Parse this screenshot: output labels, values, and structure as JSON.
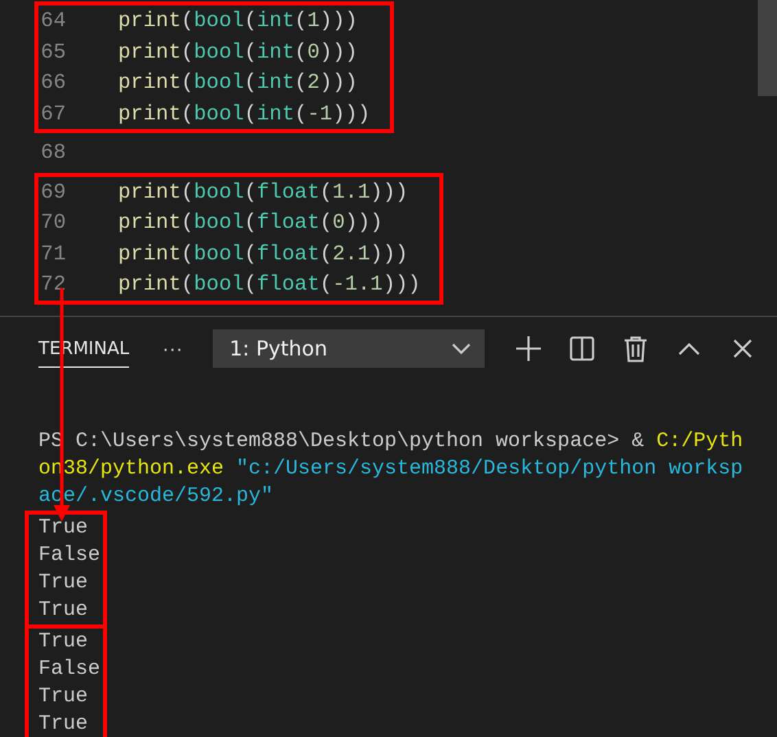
{
  "editor": {
    "blocks": [
      {
        "highlighted": true,
        "lines": [
          {
            "number": "64",
            "tokens": [
              {
                "kind": "func",
                "text": "print"
              },
              {
                "kind": "punct",
                "text": "("
              },
              {
                "kind": "type",
                "text": "bool"
              },
              {
                "kind": "punct",
                "text": "("
              },
              {
                "kind": "type",
                "text": "int"
              },
              {
                "kind": "punct",
                "text": "("
              },
              {
                "kind": "number",
                "text": "1"
              },
              {
                "kind": "punct",
                "text": ")))"
              }
            ]
          },
          {
            "number": "65",
            "tokens": [
              {
                "kind": "func",
                "text": "print"
              },
              {
                "kind": "punct",
                "text": "("
              },
              {
                "kind": "type",
                "text": "bool"
              },
              {
                "kind": "punct",
                "text": "("
              },
              {
                "kind": "type",
                "text": "int"
              },
              {
                "kind": "punct",
                "text": "("
              },
              {
                "kind": "number",
                "text": "0"
              },
              {
                "kind": "punct",
                "text": ")))"
              }
            ]
          },
          {
            "number": "66",
            "tokens": [
              {
                "kind": "func",
                "text": "print"
              },
              {
                "kind": "punct",
                "text": "("
              },
              {
                "kind": "type",
                "text": "bool"
              },
              {
                "kind": "punct",
                "text": "("
              },
              {
                "kind": "type",
                "text": "int"
              },
              {
                "kind": "punct",
                "text": "("
              },
              {
                "kind": "number",
                "text": "2"
              },
              {
                "kind": "punct",
                "text": ")))"
              }
            ]
          },
          {
            "number": "67",
            "tokens": [
              {
                "kind": "func",
                "text": "print"
              },
              {
                "kind": "punct",
                "text": "("
              },
              {
                "kind": "type",
                "text": "bool"
              },
              {
                "kind": "punct",
                "text": "("
              },
              {
                "kind": "type",
                "text": "int"
              },
              {
                "kind": "punct",
                "text": "("
              },
              {
                "kind": "number",
                "text": "-1"
              },
              {
                "kind": "punct",
                "text": ")))"
              }
            ]
          }
        ]
      },
      {
        "highlighted": false,
        "lines": [
          {
            "number": "68"
          }
        ]
      },
      {
        "highlighted": true,
        "lines": [
          {
            "number": "69",
            "tokens": [
              {
                "kind": "func",
                "text": "print"
              },
              {
                "kind": "punct",
                "text": "("
              },
              {
                "kind": "type",
                "text": "bool"
              },
              {
                "kind": "punct",
                "text": "("
              },
              {
                "kind": "type",
                "text": "float"
              },
              {
                "kind": "punct",
                "text": "("
              },
              {
                "kind": "number",
                "text": "1.1"
              },
              {
                "kind": "punct",
                "text": ")))"
              }
            ]
          },
          {
            "number": "70",
            "tokens": [
              {
                "kind": "func",
                "text": "print"
              },
              {
                "kind": "punct",
                "text": "("
              },
              {
                "kind": "type",
                "text": "bool"
              },
              {
                "kind": "punct",
                "text": "("
              },
              {
                "kind": "type",
                "text": "float"
              },
              {
                "kind": "punct",
                "text": "("
              },
              {
                "kind": "number",
                "text": "0"
              },
              {
                "kind": "punct",
                "text": ")))"
              }
            ]
          },
          {
            "number": "71",
            "tokens": [
              {
                "kind": "func",
                "text": "print"
              },
              {
                "kind": "punct",
                "text": "("
              },
              {
                "kind": "type",
                "text": "bool"
              },
              {
                "kind": "punct",
                "text": "("
              },
              {
                "kind": "type",
                "text": "float"
              },
              {
                "kind": "punct",
                "text": "("
              },
              {
                "kind": "number",
                "text": "2.1"
              },
              {
                "kind": "punct",
                "text": ")))"
              }
            ]
          },
          {
            "number": "72",
            "tokens": [
              {
                "kind": "func",
                "text": "print"
              },
              {
                "kind": "punct",
                "text": "("
              },
              {
                "kind": "type",
                "text": "bool"
              },
              {
                "kind": "punct",
                "text": "("
              },
              {
                "kind": "type",
                "text": "float"
              },
              {
                "kind": "punct",
                "text": "("
              },
              {
                "kind": "number",
                "text": "-1.1"
              },
              {
                "kind": "punct",
                "text": ")))"
              }
            ]
          }
        ]
      }
    ]
  },
  "panel": {
    "tabs": [
      {
        "label": "TERMINAL",
        "selected": true
      }
    ],
    "more": "···",
    "terminal_select": "1: Python"
  },
  "terminal": {
    "command": [
      {
        "kind": "plain",
        "text": "PS C:\\Users\\system888\\Desktop\\python workspace> & "
      },
      {
        "kind": "path",
        "text": "C:/Python38/python.exe"
      },
      {
        "kind": "string",
        "text": " \"c:/Users/system888/Desktop/python workspace/.vscode/592.py\""
      }
    ],
    "output_blocks": [
      {
        "highlighted": true,
        "lines": [
          "True",
          "False",
          "True",
          "True"
        ]
      },
      {
        "highlighted": true,
        "lines": [
          "True",
          "False",
          "True",
          "True"
        ]
      }
    ]
  }
}
